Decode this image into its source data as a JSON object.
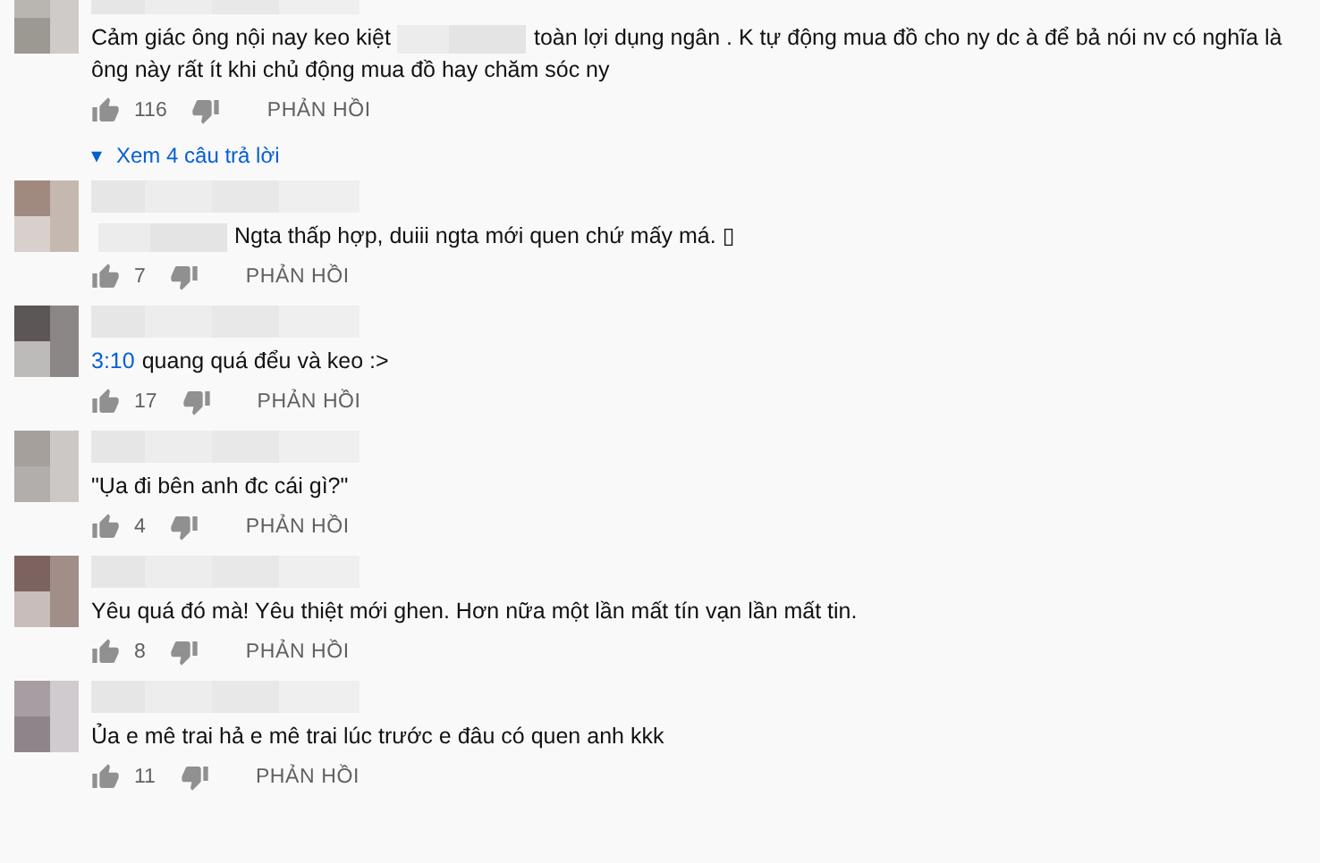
{
  "comments": [
    {
      "parts": [
        {
          "kind": "text",
          "text": "Cảm giác ông nội nay keo kiệt"
        },
        {
          "kind": "redacted"
        },
        {
          "kind": "text",
          "text": "toàn lợi dụng ngân . K tự động mua đồ cho ny dc à để bả nói nv có nghĩa là ông này rất ít khi chủ động mua đồ hay chăm sóc ny"
        }
      ],
      "likes": "116",
      "reply_label": "PHẢN HỒI",
      "replies_toggle": {
        "caret": "▾",
        "label": "Xem 4 câu trả lời"
      }
    },
    {
      "parts": [
        {
          "kind": "redacted"
        },
        {
          "kind": "text",
          "text": "Ngta thấp hợp, duiii ngta mới quen chứ mấy má. ▯"
        }
      ],
      "likes": "7",
      "reply_label": "PHẢN HỒI"
    },
    {
      "parts": [
        {
          "kind": "timestamp",
          "text": "3:10"
        },
        {
          "kind": "text",
          "text": "quang quá đểu và keo :>"
        }
      ],
      "likes": "17",
      "reply_label": "PHẢN HỒI"
    },
    {
      "parts": [
        {
          "kind": "text",
          "text": "\"Ụa đi bên anh đc cái gì?\""
        }
      ],
      "likes": "4",
      "reply_label": "PHẢN HỒI"
    },
    {
      "parts": [
        {
          "kind": "text",
          "text": "Yêu quá đó mà! Yêu thiệt mới ghen. Hơn nữa một lần mất tín vạn lần mất tin."
        }
      ],
      "likes": "8",
      "reply_label": "PHẢN HỒI"
    },
    {
      "parts": [
        {
          "kind": "text",
          "text": "Ủa e mê trai hả e mê trai lúc trước e đâu có quen anh kkk"
        }
      ],
      "likes": "11",
      "reply_label": "PHẢN HỒI"
    }
  ]
}
